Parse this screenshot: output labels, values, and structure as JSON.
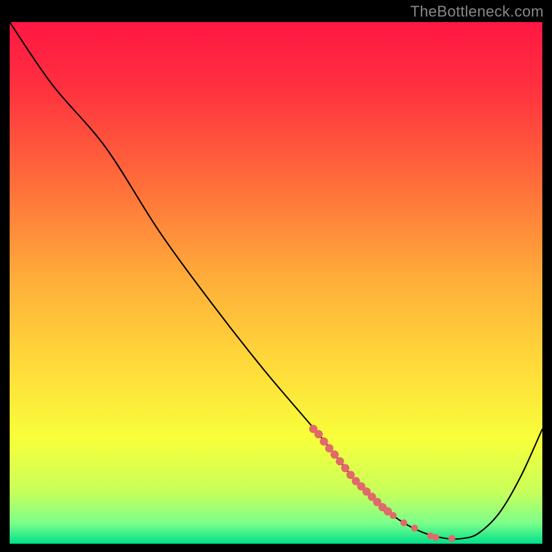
{
  "attribution": "TheBottleneck.com",
  "chart_data": {
    "type": "line",
    "title": "",
    "xlabel": "",
    "ylabel": "",
    "xlim": [
      0,
      100
    ],
    "ylim": [
      0,
      100
    ],
    "grid": false,
    "legend": false,
    "background_gradient": {
      "stops": [
        {
          "pos": 0.0,
          "color": "#ff1744"
        },
        {
          "pos": 0.12,
          "color": "#ff2f3f"
        },
        {
          "pos": 0.3,
          "color": "#ff6a3a"
        },
        {
          "pos": 0.5,
          "color": "#ffb03a"
        },
        {
          "pos": 0.68,
          "color": "#ffe03a"
        },
        {
          "pos": 0.8,
          "color": "#f7ff3a"
        },
        {
          "pos": 0.9,
          "color": "#c8ff5a"
        },
        {
          "pos": 0.96,
          "color": "#7dff8a"
        },
        {
          "pos": 1.0,
          "color": "#00e08a"
        }
      ]
    },
    "series": [
      {
        "name": "bottleneck-curve",
        "color": "#000000",
        "x": [
          0,
          8,
          18,
          28,
          38,
          48,
          58,
          65,
          70,
          74,
          78,
          82,
          85,
          88,
          92,
          96,
          100
        ],
        "y": [
          100,
          88,
          76,
          60,
          46,
          33,
          21,
          12,
          7,
          4,
          2,
          1,
          1,
          2,
          6,
          13,
          22
        ]
      }
    ],
    "highlight_points": {
      "name": "highlight-segment",
      "color": "#e06a6a",
      "radius_big": 6,
      "radius_small": 5,
      "points": [
        {
          "x": 57,
          "y": 22,
          "r": 6
        },
        {
          "x": 58,
          "y": 21,
          "r": 6
        },
        {
          "x": 59,
          "y": 19.6,
          "r": 6
        },
        {
          "x": 60,
          "y": 18.3,
          "r": 6
        },
        {
          "x": 61,
          "y": 17.1,
          "r": 6
        },
        {
          "x": 62,
          "y": 15.8,
          "r": 6
        },
        {
          "x": 63,
          "y": 14.5,
          "r": 6
        },
        {
          "x": 64,
          "y": 13.2,
          "r": 6
        },
        {
          "x": 65,
          "y": 12.0,
          "r": 6
        },
        {
          "x": 66,
          "y": 11.0,
          "r": 6
        },
        {
          "x": 67,
          "y": 10.0,
          "r": 6
        },
        {
          "x": 68,
          "y": 9.0,
          "r": 6
        },
        {
          "x": 69,
          "y": 8.0,
          "r": 6
        },
        {
          "x": 70,
          "y": 7.0,
          "r": 6
        },
        {
          "x": 71,
          "y": 6.2,
          "r": 6
        },
        {
          "x": 72,
          "y": 5.4,
          "r": 5
        },
        {
          "x": 74,
          "y": 4.0,
          "r": 5
        },
        {
          "x": 76,
          "y": 3.0,
          "r": 5
        },
        {
          "x": 79,
          "y": 1.5,
          "r": 5
        },
        {
          "x": 80,
          "y": 1.2,
          "r": 5
        },
        {
          "x": 83,
          "y": 1.0,
          "r": 5
        }
      ]
    }
  }
}
